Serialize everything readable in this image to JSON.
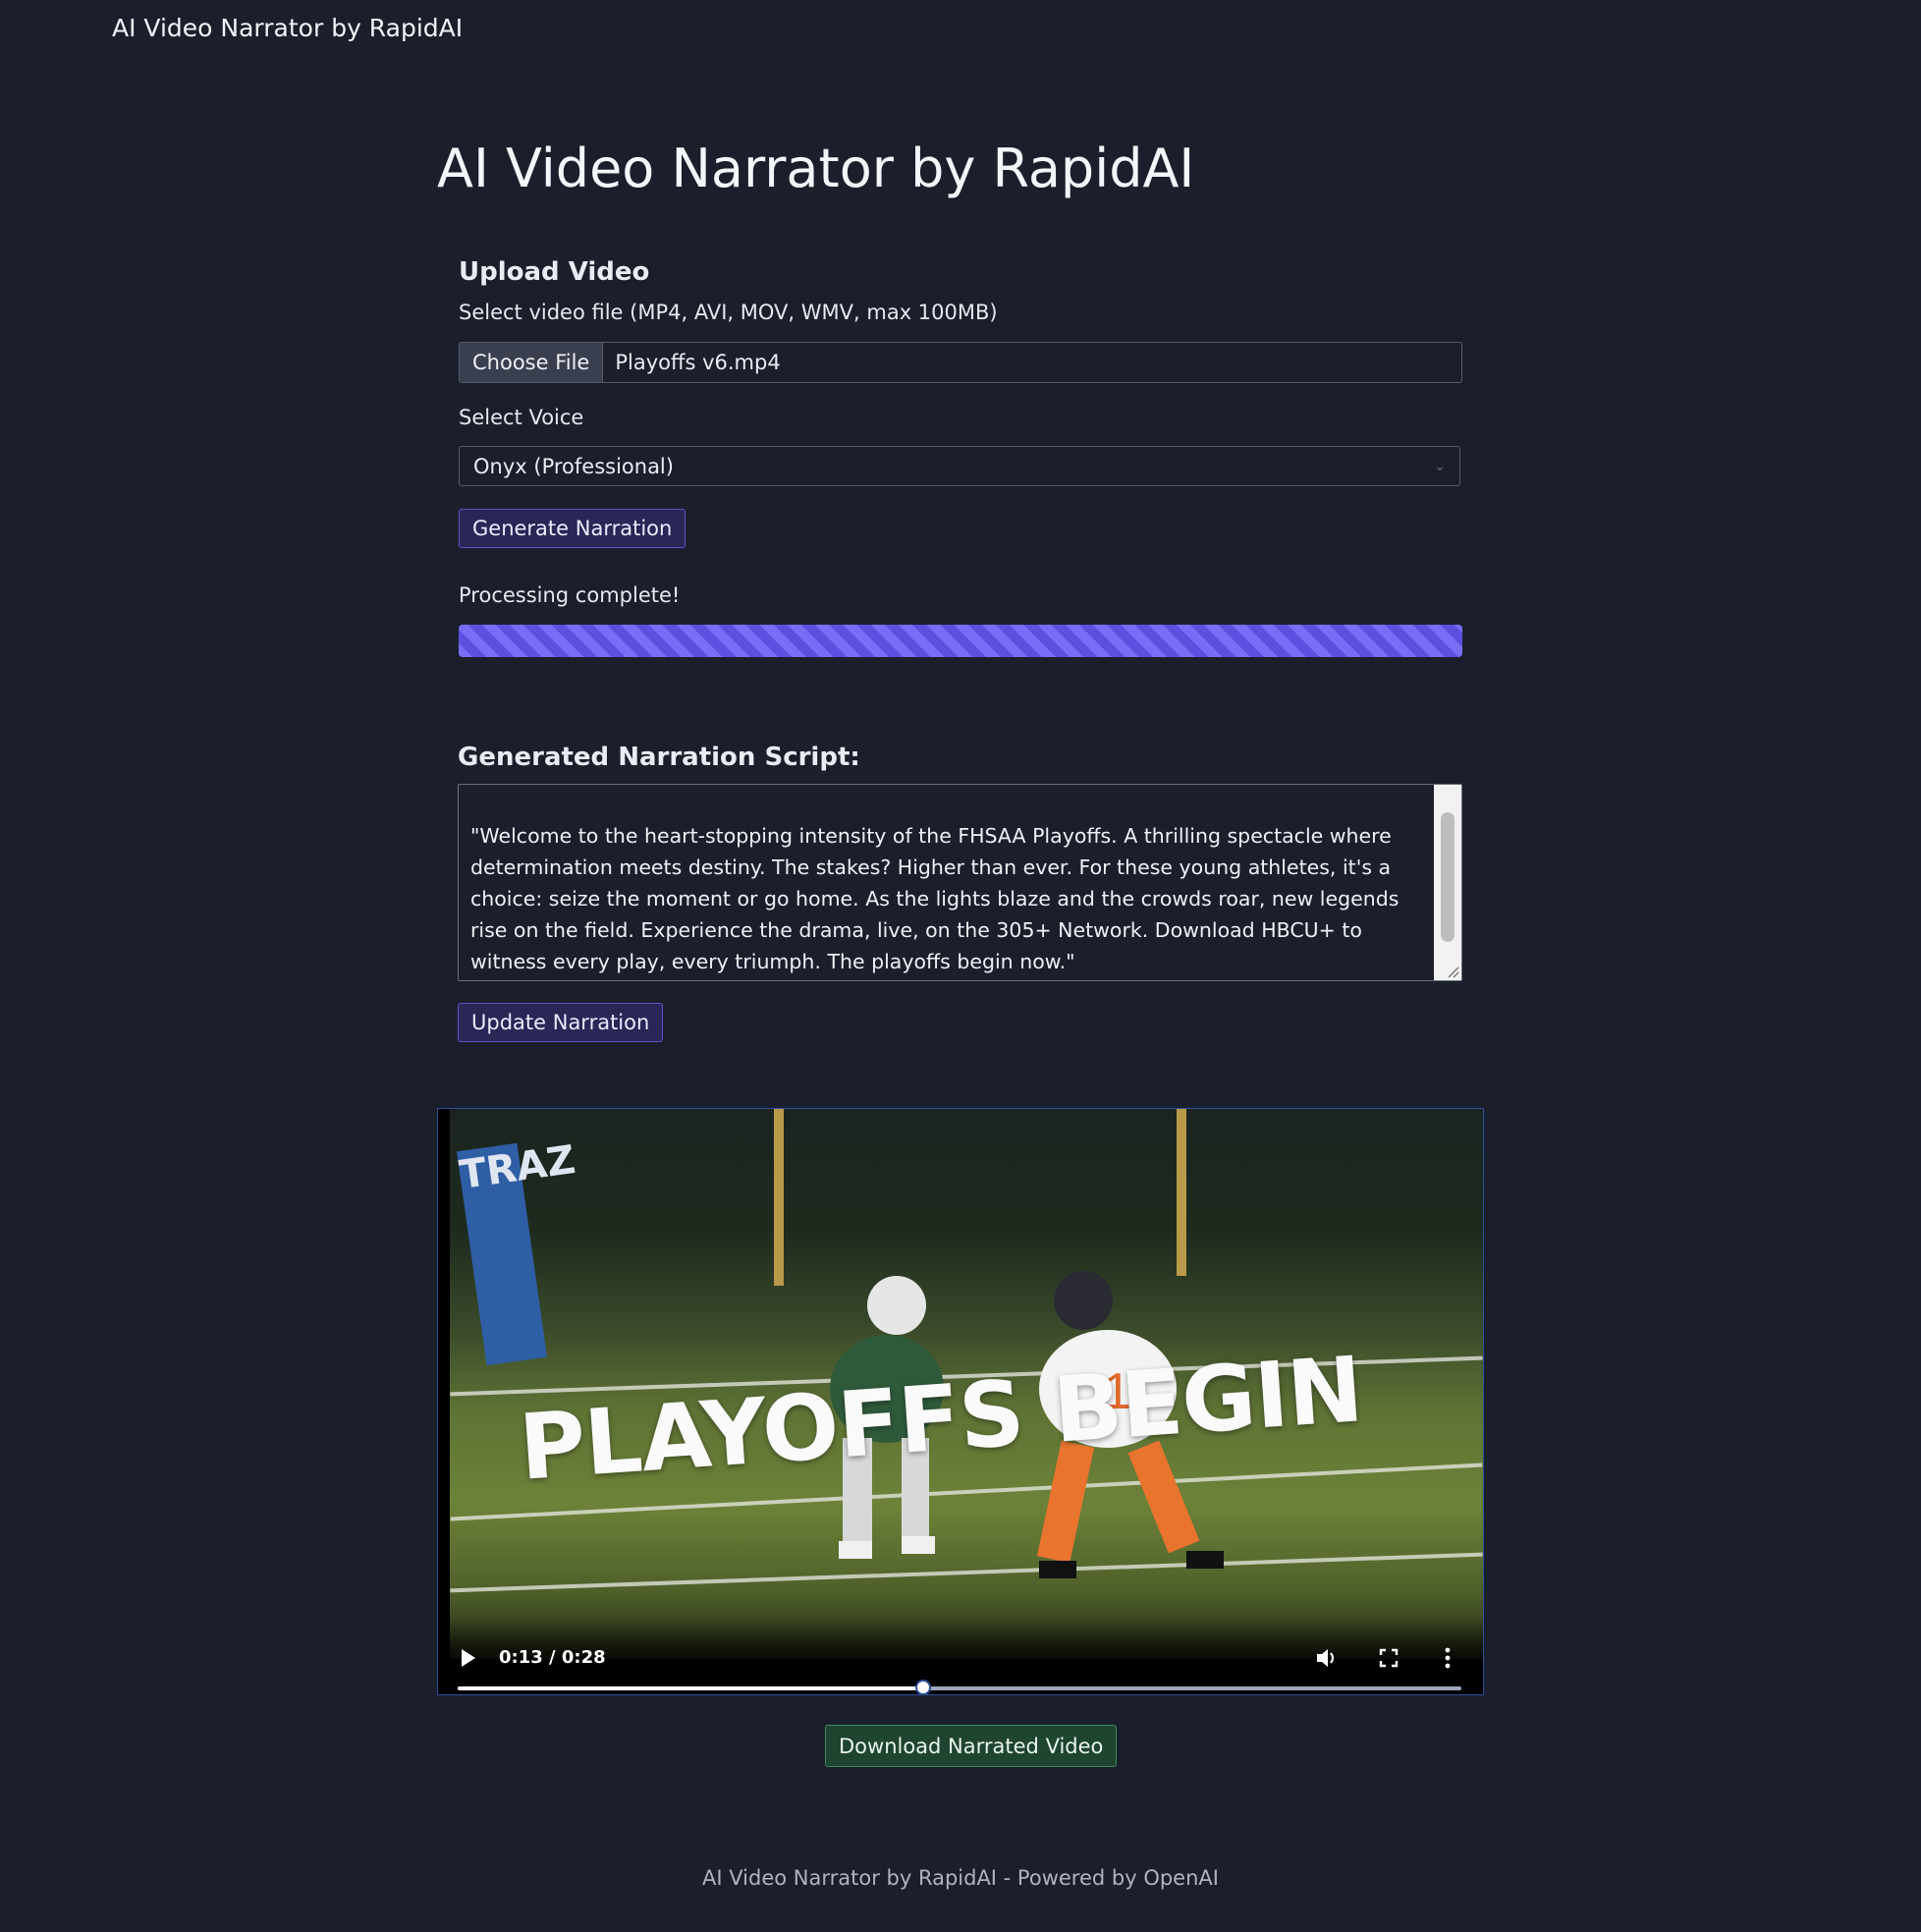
{
  "navbar": {
    "brand": "AI Video Narrator by RapidAI"
  },
  "header": {
    "title": "AI Video Narrator by RapidAI"
  },
  "upload": {
    "section_title": "Upload Video",
    "file_label": "Select video file (MP4, AVI, MOV, WMV, max 100MB)",
    "choose_file_label": "Choose File",
    "file_name": "Playoffs v6.mp4",
    "voice_label": "Select Voice",
    "voice_selected": "Onyx (Professional)",
    "generate_label": "Generate Narration"
  },
  "status": {
    "text": "Processing complete!",
    "progress_percent": 100
  },
  "script": {
    "title": "Generated Narration Script:",
    "text": "\"Welcome to the heart-stopping intensity of the FHSAA Playoffs. A thrilling spectacle where determination meets destiny. The stakes? Higher than ever. For these young athletes, it's a choice: seize the moment or go home. As the lights blaze and the crowds roar, new legends rise on the field. Experience the drama, live, on the 305+ Network. Download HBCU+ to witness every play, every triumph. The playoffs begin now.\"",
    "update_label": "Update Narration"
  },
  "video": {
    "overlay_text": "PLAYOFFS BEGIN",
    "pad_text": "TRAZ",
    "player_number": "1",
    "time_display": "0:13 / 0:28",
    "progress_fraction": 0.464,
    "icons": {
      "play": "play-icon",
      "volume": "volume-icon",
      "fullscreen": "fullscreen-icon",
      "more": "more-options-icon"
    }
  },
  "download_label": "Download Narrated Video",
  "footer": {
    "text": "AI Video Narrator by RapidAI - Powered by OpenAI"
  },
  "colors": {
    "background": "#1b1f2c",
    "primary": "#5c52c8",
    "success": "#3e8a5c",
    "progress": "#7a6cf5"
  }
}
